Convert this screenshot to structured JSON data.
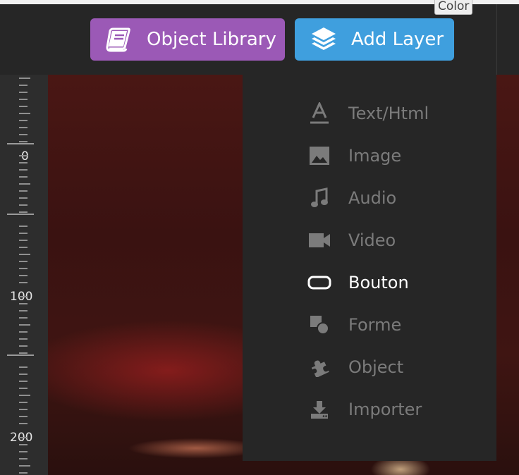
{
  "tooltip": "Color",
  "toolbar": {
    "object_library": {
      "label": "Object Library",
      "icon": "book-icon",
      "color": "#9b59b6"
    },
    "add_layer": {
      "label": "Add Layer",
      "icon": "layers-icon",
      "color": "#3f9fde"
    }
  },
  "ruler": {
    "labels": [
      "0",
      "100",
      "200"
    ]
  },
  "layer_menu": {
    "items": [
      {
        "label": "Text/Html",
        "icon": "text-icon"
      },
      {
        "label": "Image",
        "icon": "image-icon"
      },
      {
        "label": "Audio",
        "icon": "music-note-icon"
      },
      {
        "label": "Video",
        "icon": "video-camera-icon"
      },
      {
        "label": "Bouton",
        "icon": "button-shape-icon",
        "active": true
      },
      {
        "label": "Forme",
        "icon": "shape-icon"
      },
      {
        "label": "Object",
        "icon": "puzzle-icon"
      },
      {
        "label": "Importer",
        "icon": "import-icon"
      }
    ]
  }
}
